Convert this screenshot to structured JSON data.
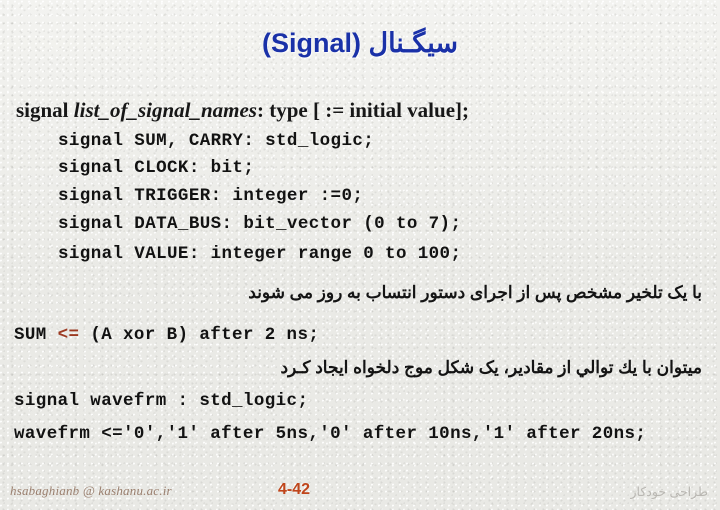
{
  "slide": {
    "background_color": "#eeeeea",
    "title": {
      "text": "سیگـنال (Signal)",
      "color": "#1a31a8"
    },
    "syntax_line": {
      "prefix": "signal ",
      "italic_part": "list_of_signal_names",
      "suffix": ": type [ := initial value];"
    },
    "code_block_1": [
      "signal SUM, CARRY: std_logic;",
      "signal CLOCK: bit;",
      "signal TRIGGER: integer :=0;",
      "signal DATA_BUS: bit_vector (0 to 7);",
      "signal VALUE: integer range 0 to 100;"
    ],
    "note_1": "با یک تلخیر مشخص پس از اجرای دستور انتساب به روز می شوند",
    "assign_sum": {
      "lhs": "SUM ",
      "operator": "<=",
      "rhs": " (A xor B) after 2 ns;",
      "operator_color": "#9c3a22"
    },
    "note_2": "میتوان با يك توالي از مقادیر، یک شکل موج دلخواه ایجاد کـرد",
    "code_block_2": [
      "signal wavefrm : std_logic;",
      "wavefrm <='0','1' after 5ns,'0' after 10ns,'1' after 20ns;"
    ],
    "footer": {
      "email": "hsabaghianb @ kashanu.ac.ir",
      "page_number": "4-42",
      "page_number_color": "#c0451b",
      "right_label": "طراحی خودکار"
    }
  }
}
